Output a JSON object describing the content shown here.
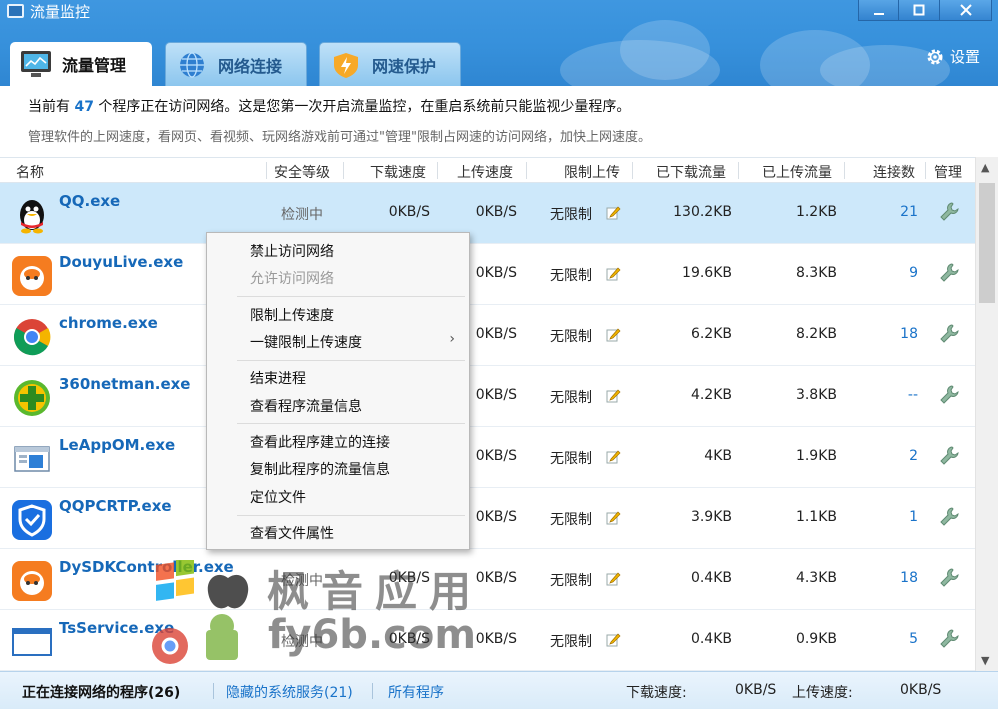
{
  "window": {
    "title": "流量监控",
    "controls": [
      "minimize",
      "maximize",
      "close"
    ]
  },
  "tabs": [
    {
      "label": "流量管理",
      "icon": "monitor-icon",
      "active": true
    },
    {
      "label": "网络连接",
      "icon": "globe-icon",
      "active": false
    },
    {
      "label": "网速保护",
      "icon": "speed-shield-icon",
      "active": false
    }
  ],
  "settings_label": "设置",
  "info": {
    "line1_pre": "当前有",
    "count": "47",
    "line1_post": "个程序正在访问网络。这是您第一次开启流量监控，在重启系统前只能监视少量程序。",
    "line2": "管理软件的上网速度，看网页、看视频、玩网络游戏前可通过\"管理\"限制占网速的访问网络，加快上网速度。"
  },
  "columns": {
    "name": "名称",
    "security": "安全等级",
    "download_speed": "下载速度",
    "upload_speed": "上传速度",
    "upload_limit": "限制上传",
    "downloaded": "已下载流量",
    "uploaded": "已上传流量",
    "connections": "连接数",
    "manage": "管理"
  },
  "rows": [
    {
      "name": "QQ.exe",
      "icon": "qq-penguin-icon",
      "security": "检测中",
      "dl": "0KB/S",
      "ul": "0KB/S",
      "limit": "无限制",
      "dl_total": "130.2KB",
      "ul_total": "1.2KB",
      "conn": "21"
    },
    {
      "name": "DouyuLive.exe",
      "icon": "douyu-icon",
      "security": "",
      "dl": "",
      "ul": "0KB/S",
      "limit": "无限制",
      "dl_total": "19.6KB",
      "ul_total": "8.3KB",
      "conn": "9"
    },
    {
      "name": "chrome.exe",
      "icon": "chrome-icon",
      "security": "",
      "dl": "",
      "ul": "0KB/S",
      "limit": "无限制",
      "dl_total": "6.2KB",
      "ul_total": "8.2KB",
      "conn": "18"
    },
    {
      "name": "360netman.exe",
      "icon": "360-icon",
      "security": "",
      "dl": "",
      "ul": "0KB/S",
      "limit": "无限制",
      "dl_total": "4.2KB",
      "ul_total": "3.8KB",
      "conn": "--"
    },
    {
      "name": "LeAppOM.exe",
      "icon": "window-app-icon",
      "security": "",
      "dl": "",
      "ul": "0KB/S",
      "limit": "无限制",
      "dl_total": "4KB",
      "ul_total": "1.9KB",
      "conn": "2"
    },
    {
      "name": "QQPCRTP.exe",
      "icon": "shield-app-icon",
      "security": "",
      "dl": "",
      "ul": "0KB/S",
      "limit": "无限制",
      "dl_total": "3.9KB",
      "ul_total": "1.1KB",
      "conn": "1"
    },
    {
      "name": "DySDKController.exe",
      "icon": "douyu-icon",
      "security": "检测中",
      "dl": "0KB/S",
      "ul": "0KB/S",
      "limit": "无限制",
      "dl_total": "0.4KB",
      "ul_total": "4.3KB",
      "conn": "18"
    },
    {
      "name": "TsService.exe",
      "icon": "window-app-icon",
      "security": "检测中",
      "dl": "0KB/S",
      "ul": "0KB/S",
      "limit": "无限制",
      "dl_total": "0.4KB",
      "ul_total": "0.9KB",
      "conn": "5"
    }
  ],
  "context_menu": {
    "items": [
      {
        "label": "禁止访问网络",
        "disabled": false
      },
      {
        "label": "允许访问网络",
        "disabled": true
      },
      {
        "label": "限制上传速度",
        "disabled": false
      },
      {
        "label": "一键限制上传速度",
        "disabled": false,
        "submenu": true
      },
      {
        "label": "结束进程",
        "disabled": false
      },
      {
        "label": "查看程序流量信息",
        "disabled": false
      },
      {
        "label": "查看此程序建立的连接",
        "disabled": false
      },
      {
        "label": "复制此程序的流量信息",
        "disabled": false
      },
      {
        "label": "定位文件",
        "disabled": false
      },
      {
        "label": "查看文件属性",
        "disabled": false
      }
    ]
  },
  "watermark": {
    "text": "枫音应用",
    "url": "fy6b.com"
  },
  "footer": {
    "active_tab": "正在连接网络的程序(26)",
    "hidden_services": "隐藏的系统服务(21)",
    "all_programs": "所有程序",
    "download_label": "下载速度:",
    "download_value": "0KB/S",
    "upload_label": "上传速度:",
    "upload_value": "0KB/S"
  },
  "colors": {
    "header_blue": "#3690db",
    "link_blue": "#1a73c9",
    "selected_row": "#cde8fa"
  }
}
